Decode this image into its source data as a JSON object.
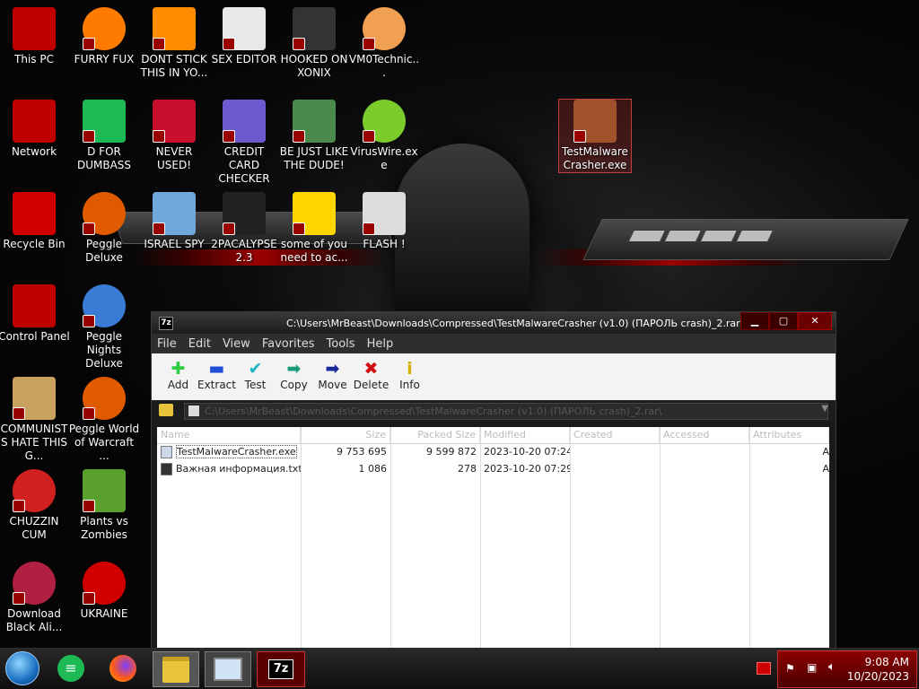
{
  "desktop": {
    "icons": [
      {
        "label": "This PC",
        "icon": "monitor-icon",
        "color": "#c00000"
      },
      {
        "label": "FURRY FUX",
        "icon": "firefox-icon",
        "color": "#ff7a00"
      },
      {
        "label": "DONT STICK THIS IN YO...",
        "icon": "traffic-cone-icon",
        "color": "#ff8c00"
      },
      {
        "label": "SEX EDITOR",
        "icon": "hxd-editor-icon",
        "color": "#e8e8e8"
      },
      {
        "label": "HOOKED ON XONIX",
        "icon": "xonix-game-icon",
        "color": "#333333"
      },
      {
        "label": "VM0Technic...",
        "icon": "doctor-avatar-icon",
        "color": "#f0a050"
      },
      {
        "label": "Network",
        "icon": "network-icon",
        "color": "#c00000"
      },
      {
        "label": "D FOR DUMBASS",
        "icon": "chat-bubble-icon",
        "color": "#1db954"
      },
      {
        "label": "NEVER USED!",
        "icon": "dev-cpp-icon",
        "color": "#c8102e"
      },
      {
        "label": "CREDIT CARD CHECKER",
        "icon": "credit-card-icon",
        "color": "#6a5acd"
      },
      {
        "label": "BE JUST LIKE THE DUDE!",
        "icon": "elf-face-icon",
        "color": "#4a8a4a"
      },
      {
        "label": "VirusWire.exe",
        "icon": "lime-wheel-icon",
        "color": "#7ccd2c"
      },
      {
        "label": "Recycle Bin",
        "icon": "recycle-bin-icon",
        "color": "#d00000"
      },
      {
        "label": "Peggle Deluxe",
        "icon": "peggle-icon",
        "color": "#e05a00"
      },
      {
        "label": "ISRAEL SPY",
        "icon": "spy-network-icon",
        "color": "#6fa8dc"
      },
      {
        "label": "2PACALYPSE 2.3",
        "icon": "terminal-icon",
        "color": "#222222"
      },
      {
        "label": "some of you need to ac...",
        "icon": "beaver-icon",
        "color": "#ffd700"
      },
      {
        "label": "FLASH !",
        "icon": "flash-folder-icon",
        "color": "#dddddd"
      },
      {
        "label": "Control Panel",
        "icon": "control-panel-icon",
        "color": "#c00000"
      },
      {
        "label": "Peggle Nights Deluxe",
        "icon": "peggle-nights-icon",
        "color": "#3a7bd5"
      },
      {
        "label": "COMMUNISTS HATE THIS G...",
        "icon": "money-bag-icon",
        "color": "#c8a060"
      },
      {
        "label": "Peggle World of Warcraft ...",
        "icon": "peggle-wow-icon",
        "color": "#e05a00"
      },
      {
        "label": "CHUZZIN CUM",
        "icon": "chuzzle-icon",
        "color": "#d02020"
      },
      {
        "label": "Plants vs Zombies",
        "icon": "flower-icon",
        "color": "#5aa02c"
      },
      {
        "label": "Download Black Ali...",
        "icon": "alien-orb-icon",
        "color": "#b02040"
      },
      {
        "label": "UKRAINE",
        "icon": "radiation-icon",
        "color": "#d00000"
      },
      {
        "label": "TestMalwareCrasher.exe",
        "icon": "winrar-archive-icon",
        "color": "#a0522d"
      }
    ]
  },
  "window": {
    "title": "C:\\Users\\MrBeast\\Downloads\\Compressed\\TestMalwareCrasher (v1.0) (ПАРОЛЬ crash)_2.rar\\",
    "app_icon": "7z",
    "menu": [
      "File",
      "Edit",
      "View",
      "Favorites",
      "Tools",
      "Help"
    ],
    "toolbar": [
      {
        "label": "Add",
        "icon": "plus-icon",
        "color": "#2ecc40",
        "glyph": "✚"
      },
      {
        "label": "Extract",
        "icon": "minus-icon",
        "color": "#1f4fd6",
        "glyph": "▬"
      },
      {
        "label": "Test",
        "icon": "check-icon",
        "color": "#1fb6c8",
        "glyph": "✔"
      },
      {
        "label": "Copy",
        "icon": "copy-arrow-icon",
        "color": "#1a9a7a",
        "glyph": "➡"
      },
      {
        "label": "Move",
        "icon": "move-arrow-icon",
        "color": "#1a2a9a",
        "glyph": "➡"
      },
      {
        "label": "Delete",
        "icon": "delete-x-icon",
        "color": "#d01010",
        "glyph": "✖"
      },
      {
        "label": "Info",
        "icon": "info-icon",
        "color": "#d4b000",
        "glyph": "i"
      }
    ],
    "columns": [
      "Name",
      "Size",
      "Packed Size",
      "Modified",
      "Created",
      "Accessed",
      "Attributes"
    ],
    "files": [
      {
        "name": "TestMalwareCrasher.exe",
        "size": "9 753 695",
        "packed": "9 599 872",
        "modified": "2023-10-20 07:24",
        "attr": "A"
      },
      {
        "name": "Важная информация.txt",
        "size": "1 086",
        "packed": "278",
        "modified": "2023-10-20 07:29",
        "attr": "A"
      }
    ]
  },
  "taskbar": {
    "time": "9:08 AM",
    "date": "10/20/2023",
    "app_7z": "7z"
  }
}
